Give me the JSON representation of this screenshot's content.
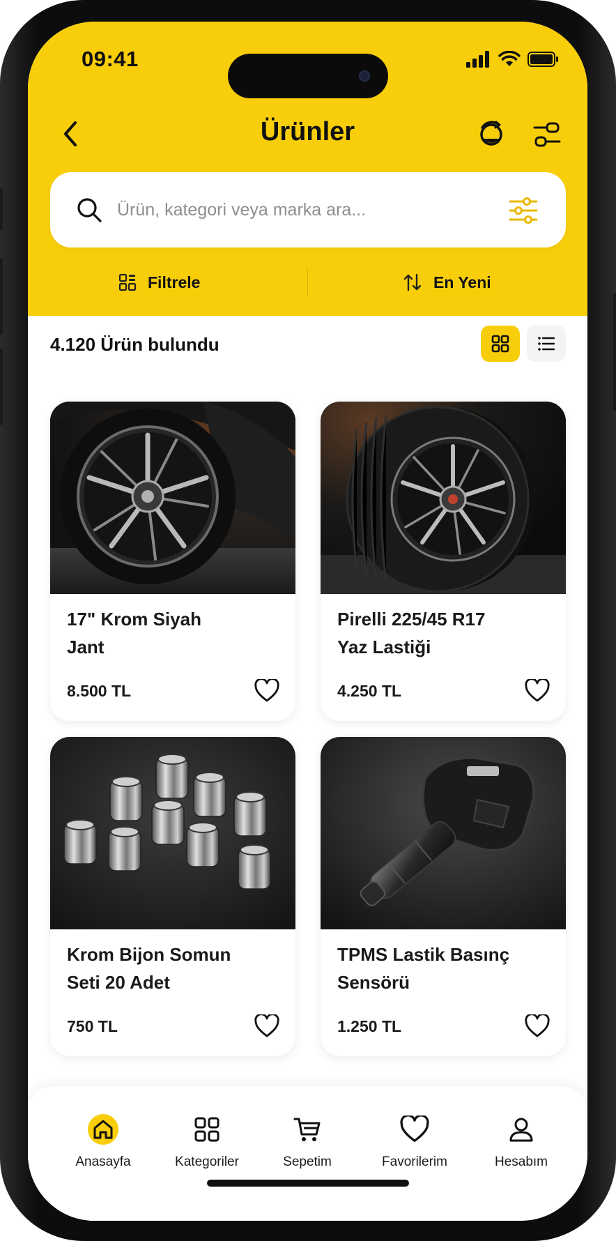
{
  "status": {
    "time": "09:41"
  },
  "header": {
    "title": "Ürünler"
  },
  "search": {
    "placeholder": "Ürün, kategori veya marka ara..."
  },
  "filters": {
    "filter_label": "Filtrele",
    "sort_label": "En Yeni"
  },
  "results": {
    "count_text": "4.120 Ürün bulundu",
    "active_view": "grid"
  },
  "products": [
    {
      "name_line1": "17\" Krom Siyah",
      "name_line2": "Jant",
      "price": "8.500 TL",
      "image": "black-chrome-wheel"
    },
    {
      "name_line1": "Pirelli 225/45 R17",
      "name_line2": "Yaz Lastiği",
      "price": "4.250 TL",
      "image": "summer-tire"
    },
    {
      "name_line1": "Krom Bijon Somun",
      "name_line2": "Seti 20 Adet",
      "price": "750 TL",
      "image": "chrome-lug-nuts"
    },
    {
      "name_line1": "TPMS Lastik Basınç",
      "name_line2": "Sensörü",
      "price": "1.250 TL",
      "image": "tpms-sensor"
    }
  ],
  "bottom_nav": {
    "active": "Anasayfa",
    "items": [
      {
        "label": "Anasayfa",
        "icon": "home-icon"
      },
      {
        "label": "Kategoriler",
        "icon": "grid-icon"
      },
      {
        "label": "Sepetim",
        "icon": "cart-icon"
      },
      {
        "label": "Favorilerim",
        "icon": "heart-icon"
      },
      {
        "label": "Hesabım",
        "icon": "user-icon"
      }
    ]
  },
  "colors": {
    "accent": "#f8ce0a",
    "text": "#111111",
    "card_bg": "#ffffff"
  }
}
